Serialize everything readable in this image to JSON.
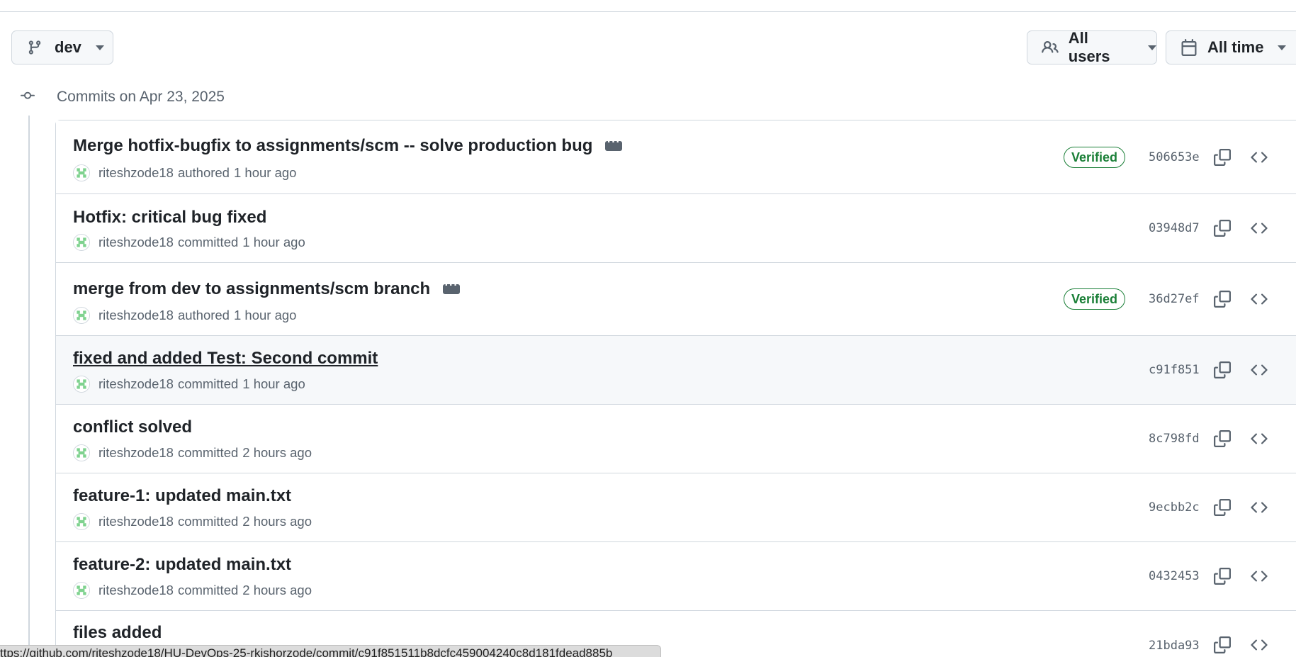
{
  "toolbar": {
    "branch_label": "dev",
    "users_label": "All users",
    "time_label": "All time"
  },
  "group": {
    "heading": "Commits on Apr 23, 2025"
  },
  "commits": [
    {
      "title": "Merge hotfix-bugfix to assignments/scm -- solve production bug",
      "author": "riteshzode18",
      "action": "authored",
      "time": "1 hour ago",
      "verified": "Verified",
      "sha": "506653e",
      "has_ellipsis": true
    },
    {
      "title": "Hotfix: critical bug fixed",
      "author": "riteshzode18",
      "action": "committed",
      "time": "1 hour ago",
      "verified": "",
      "sha": "03948d7",
      "has_ellipsis": false
    },
    {
      "title": "merge from dev to assignments/scm branch",
      "author": "riteshzode18",
      "action": "authored",
      "time": "1 hour ago",
      "verified": "Verified",
      "sha": "36d27ef",
      "has_ellipsis": true
    },
    {
      "title": "fixed and added Test: Second commit",
      "author": "riteshzode18",
      "action": "committed",
      "time": "1 hour ago",
      "verified": "",
      "sha": "c91f851",
      "has_ellipsis": false
    },
    {
      "title": "conflict solved",
      "author": "riteshzode18",
      "action": "committed",
      "time": "2 hours ago",
      "verified": "",
      "sha": "8c798fd",
      "has_ellipsis": false
    },
    {
      "title": "feature-1: updated main.txt",
      "author": "riteshzode18",
      "action": "committed",
      "time": "2 hours ago",
      "verified": "",
      "sha": "9ecbb2c",
      "has_ellipsis": false
    },
    {
      "title": "feature-2: updated main.txt",
      "author": "riteshzode18",
      "action": "committed",
      "time": "2 hours ago",
      "verified": "",
      "sha": "0432453",
      "has_ellipsis": false
    },
    {
      "title": "files added",
      "author": "",
      "action": "",
      "time": "",
      "verified": "",
      "sha": "21bda93",
      "has_ellipsis": false
    }
  ],
  "status_bar": {
    "url": "ttps://github.com/riteshzode18/HU-DevOps-25-rkishorzode/commit/c91f851511b8dcfc459004240c8d181fdead885b"
  },
  "colors": {
    "verified": "#1a7f37",
    "border": "#d0d7de",
    "muted": "#59636e",
    "hover_row": "#f6f8fa"
  },
  "icons": {
    "branch": "git-branch-icon",
    "users": "people-icon",
    "calendar": "calendar-icon",
    "commit": "git-commit-icon",
    "copy": "copy-icon",
    "code": "code-icon"
  }
}
